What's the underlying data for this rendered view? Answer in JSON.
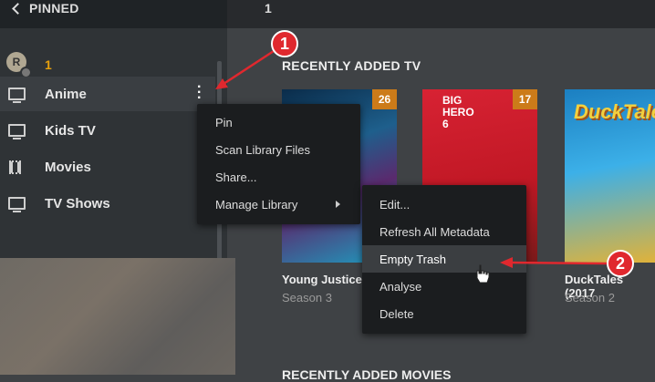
{
  "header": {
    "pinned_label": "PINNED",
    "page_number": "1"
  },
  "sidebar": {
    "user_initial": "R",
    "user_count": "1",
    "items": [
      {
        "label": "Anime",
        "icon": "tv-icon"
      },
      {
        "label": "Kids TV",
        "icon": "tv-icon"
      },
      {
        "label": "Movies",
        "icon": "film-icon"
      },
      {
        "label": "TV Shows",
        "icon": "tv-icon"
      }
    ]
  },
  "context_menu": {
    "items": [
      "Pin",
      "Scan Library Files",
      "Share...",
      "Manage Library"
    ]
  },
  "manage_submenu": {
    "items": [
      "Edit...",
      "Refresh All Metadata",
      "Empty Trash",
      "Analyse",
      "Delete"
    ],
    "highlighted": "Empty Trash"
  },
  "main": {
    "recently_added_tv": "RECENTLY ADDED TV",
    "recently_added_movies": "RECENTLY ADDED MOVIES",
    "posters": [
      {
        "title": "Young Justice",
        "subtitle": "Season 3",
        "badge": "26"
      },
      {
        "title": "",
        "subtitle": "",
        "badge": "17",
        "poster_text": "BIG HERO 6"
      },
      {
        "title": "DuckTales (2017",
        "subtitle": "Season 2",
        "badge": "",
        "poster_text": "DuckTales"
      }
    ]
  },
  "annotations": {
    "callout_1": "1",
    "callout_2": "2"
  },
  "colors": {
    "accent": "#e5a00d",
    "badge": "#cc7b19",
    "callout": "#e0282e"
  }
}
